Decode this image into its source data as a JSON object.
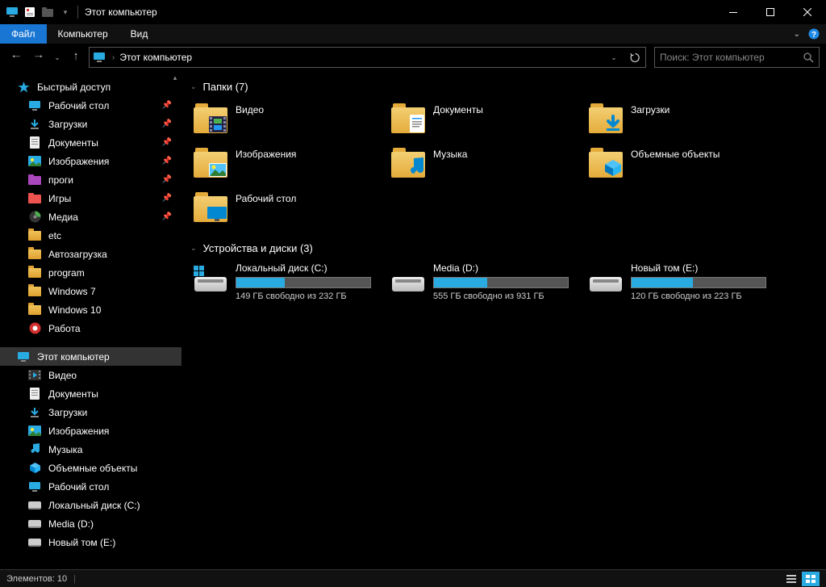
{
  "window": {
    "title": "Этот компьютер"
  },
  "menu": {
    "file": "Файл",
    "computer": "Компьютер",
    "view": "Вид"
  },
  "address": {
    "root": "Этот компьютер",
    "search_placeholder": "Поиск: Этот компьютер"
  },
  "sidebar": {
    "quick_access": "Быстрый доступ",
    "quick_items": [
      {
        "label": "Рабочий стол",
        "icon": "desktop",
        "pinned": true
      },
      {
        "label": "Загрузки",
        "icon": "downloads",
        "pinned": true
      },
      {
        "label": "Документы",
        "icon": "documents",
        "pinned": true
      },
      {
        "label": "Изображения",
        "icon": "pictures",
        "pinned": true
      },
      {
        "label": "проги",
        "icon": "folder-color",
        "pinned": true
      },
      {
        "label": "Игры",
        "icon": "folder-color2",
        "pinned": true
      },
      {
        "label": "Медиа",
        "icon": "media",
        "pinned": true
      },
      {
        "label": "etc",
        "icon": "folder",
        "pinned": false
      },
      {
        "label": "Автозагрузка",
        "icon": "folder",
        "pinned": false
      },
      {
        "label": "program",
        "icon": "folder",
        "pinned": false
      },
      {
        "label": "Windows 7",
        "icon": "folder",
        "pinned": false
      },
      {
        "label": "Windows 10",
        "icon": "folder",
        "pinned": false
      },
      {
        "label": "Работа",
        "icon": "work",
        "pinned": false
      }
    ],
    "this_pc": "Этот компьютер",
    "pc_items": [
      {
        "label": "Видео",
        "icon": "video"
      },
      {
        "label": "Документы",
        "icon": "documents"
      },
      {
        "label": "Загрузки",
        "icon": "downloads"
      },
      {
        "label": "Изображения",
        "icon": "pictures"
      },
      {
        "label": "Музыка",
        "icon": "music"
      },
      {
        "label": "Объемные объекты",
        "icon": "3d"
      },
      {
        "label": "Рабочий стол",
        "icon": "desktop"
      },
      {
        "label": "Локальный диск (C:)",
        "icon": "disk"
      },
      {
        "label": "Media (D:)",
        "icon": "disk"
      },
      {
        "label": "Новый том (E:)",
        "icon": "disk"
      }
    ]
  },
  "content": {
    "folders_header": "Папки (7)",
    "folders": [
      {
        "label": "Видео",
        "overlay": "video"
      },
      {
        "label": "Документы",
        "overlay": "doc"
      },
      {
        "label": "Загрузки",
        "overlay": "download"
      },
      {
        "label": "Изображения",
        "overlay": "picture"
      },
      {
        "label": "Музыка",
        "overlay": "music"
      },
      {
        "label": "Объемные объекты",
        "overlay": "3d"
      },
      {
        "label": "Рабочий стол",
        "overlay": "desktop"
      }
    ],
    "drives_header": "Устройства и диски (3)",
    "drives": [
      {
        "name": "Локальный диск (C:)",
        "free_text": "149 ГБ свободно из 232 ГБ",
        "fill_pct": 36,
        "os": true
      },
      {
        "name": "Media (D:)",
        "free_text": "555 ГБ свободно из 931 ГБ",
        "fill_pct": 40,
        "os": false
      },
      {
        "name": "Новый том (E:)",
        "free_text": "120 ГБ свободно из 223 ГБ",
        "fill_pct": 46,
        "os": false
      }
    ]
  },
  "status": {
    "items": "Элементов: 10"
  }
}
